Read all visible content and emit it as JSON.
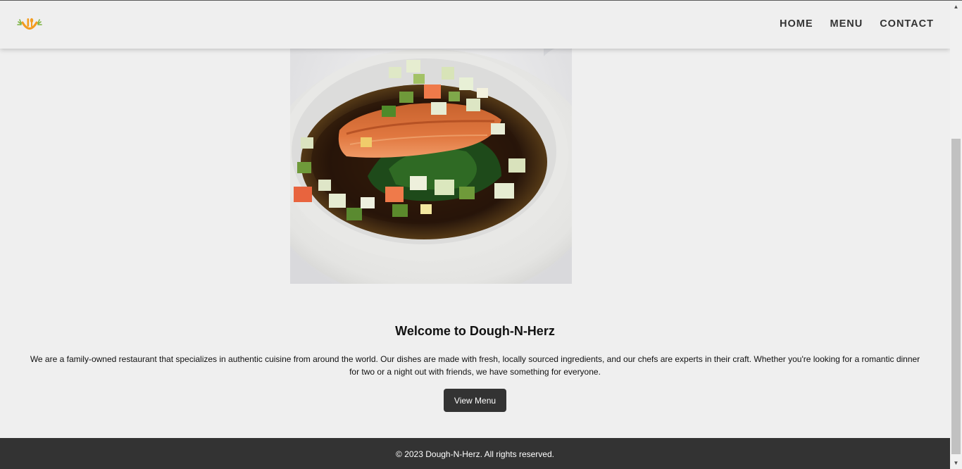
{
  "header": {
    "logo_icon": "chef-utensils-logo-icon",
    "nav": [
      {
        "label": "HOME"
      },
      {
        "label": "MENU"
      },
      {
        "label": "CONTACT"
      }
    ]
  },
  "hero": {
    "image_icon": "salmon-dish-photo"
  },
  "welcome": {
    "title": "Welcome to Dough-N-Herz",
    "text": "We are a family-owned restaurant that specializes in authentic cuisine from around the world. Our dishes are made with fresh, locally sourced ingredients, and our chefs are experts in their craft. Whether you're looking for a romantic dinner for two or a night out with friends, we have something for everyone.",
    "button_label": "View Menu"
  },
  "footer": {
    "text": "© 2023 Dough-N-Herz. All rights reserved."
  },
  "colors": {
    "background": "#efefef",
    "dark": "#333333",
    "logo_orange": "#f39c1f",
    "logo_green": "#7cb342"
  }
}
